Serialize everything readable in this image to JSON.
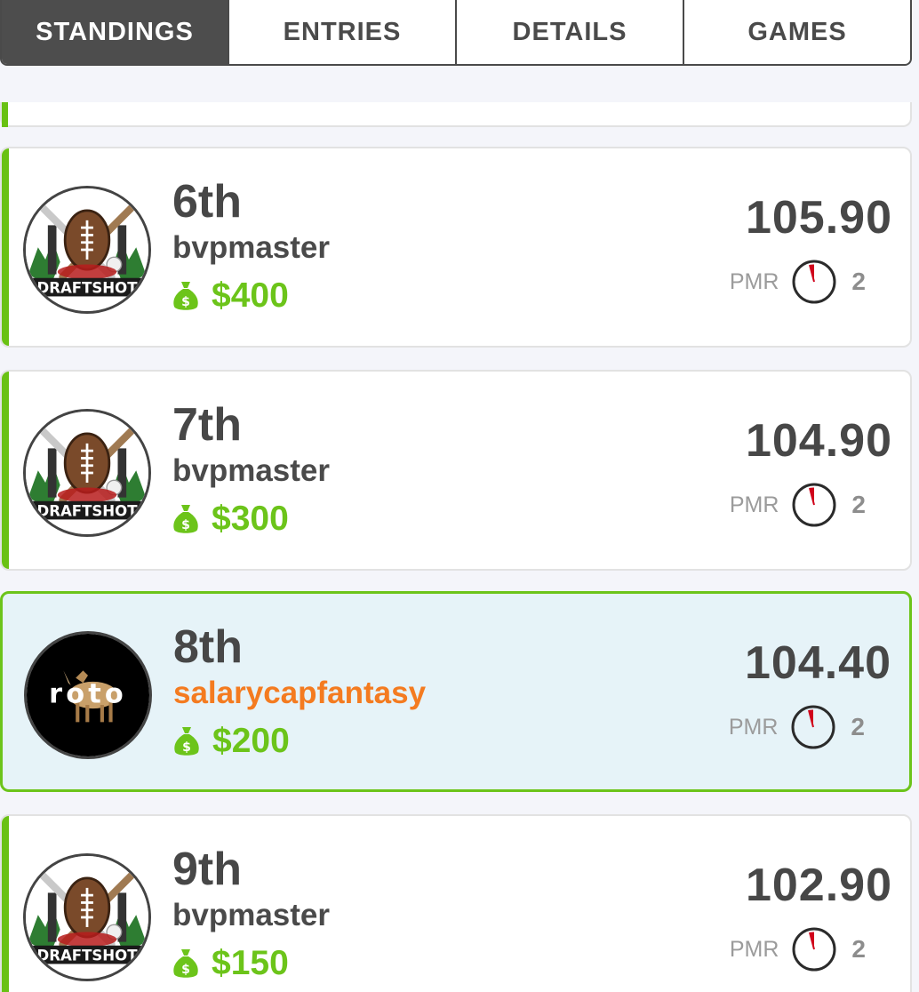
{
  "tabs": [
    {
      "label": "STANDINGS",
      "active": true
    },
    {
      "label": "ENTRIES",
      "active": false
    },
    {
      "label": "DETAILS",
      "active": false
    },
    {
      "label": "GAMES",
      "active": false
    }
  ],
  "entries": [
    {
      "rank": "6th",
      "username": "bvpmaster",
      "prize": "$400",
      "score": "105.90",
      "pmr_label": "PMR",
      "pmr_value": "2",
      "avatar": "draftshot-logo",
      "avatar_text": "DRAFTSHOT",
      "highlight": false
    },
    {
      "rank": "7th",
      "username": "bvpmaster",
      "prize": "$300",
      "score": "104.90",
      "pmr_label": "PMR",
      "pmr_value": "2",
      "avatar": "draftshot-logo",
      "avatar_text": "DRAFTSHOT",
      "highlight": false
    },
    {
      "rank": "8th",
      "username": "salarycapfantasy",
      "prize": "$200",
      "score": "104.40",
      "pmr_label": "PMR",
      "pmr_value": "2",
      "avatar": "roto-goat-logo",
      "avatar_text": "roto",
      "highlight": true
    },
    {
      "rank": "9th",
      "username": "bvpmaster",
      "prize": "$150",
      "score": "102.90",
      "pmr_label": "PMR",
      "pmr_value": "2",
      "avatar": "draftshot-logo",
      "avatar_text": "DRAFTSHOT",
      "highlight": false
    }
  ],
  "colors": {
    "accent_green": "#69c113",
    "prize_green": "#6cc41a",
    "highlight_bg": "#e6f3f8",
    "username_highlight": "#f47b20",
    "pmr_red": "#d0021b"
  },
  "icons": {
    "prize": "money-bag-icon",
    "pmr": "pmr-clock-icon"
  }
}
